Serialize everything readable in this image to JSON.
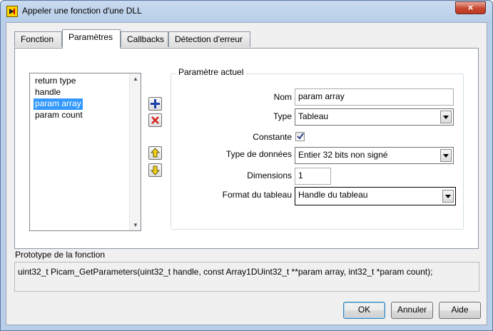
{
  "window": {
    "title": "Appeler une fonction d'une DLL",
    "close_glyph": "×",
    "icons": {
      "app": "labview-dll-icon",
      "close": "close-icon"
    }
  },
  "tabs": [
    {
      "label": "Fonction",
      "active": false
    },
    {
      "label": "Paramètres",
      "active": true
    },
    {
      "label": "Callbacks",
      "active": false
    },
    {
      "label": "Détection d'erreur",
      "active": false
    }
  ],
  "param_list": {
    "items": [
      "return type",
      "handle",
      "param array",
      "param count"
    ],
    "selected_index": 2
  },
  "toolbar": {
    "add": "add-parameter-icon",
    "delete": "delete-parameter-icon",
    "move_up": "move-up-icon",
    "move_down": "move-down-icon"
  },
  "current_param": {
    "group_title": "Paramètre actuel",
    "name_label": "Nom",
    "name_value": "param array",
    "type_label": "Type",
    "type_value": "Tableau",
    "const_label": "Constante",
    "const_checked": true,
    "datatype_label": "Type de données",
    "datatype_value": "Entier 32 bits non signé",
    "dims_label": "Dimensions",
    "dims_value": "1",
    "format_label": "Format du tableau",
    "format_value": "Handle du tableau"
  },
  "prototype": {
    "label": "Prototype de la fonction",
    "text": "uint32_t Picam_GetParameters(uint32_t handle, const Array1DUint32_t **param array, int32_t *param count);"
  },
  "buttons": {
    "ok": "OK",
    "cancel": "Annuler",
    "help": "Aide"
  },
  "colors": {
    "selection": "#3399ff",
    "title_bar": "#b9cfe9",
    "add_icon": "#1a3fa8",
    "delete_icon": "#d4231e",
    "arrow_icon": "#e8c000"
  }
}
